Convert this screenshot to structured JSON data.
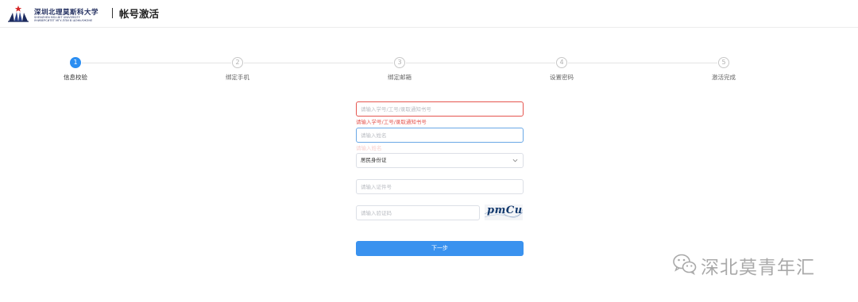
{
  "header": {
    "logo": {
      "name_cn": "深圳北理莫斯科大学",
      "name_en_lines": [
        "SHENZHEN MSU-BIT UNIVERSITY",
        "УНИВЕРСИТЕТ МГУ-ППИ В ШЭНЬЧЖЭНЕ"
      ]
    },
    "title": "帐号激活"
  },
  "steps": [
    {
      "number": "1",
      "label": "信息校验",
      "active": true
    },
    {
      "number": "2",
      "label": "绑定手机",
      "active": false
    },
    {
      "number": "3",
      "label": "绑定邮箱",
      "active": false
    },
    {
      "number": "4",
      "label": "设置密码",
      "active": false
    },
    {
      "number": "5",
      "label": "激活完成",
      "active": false
    }
  ],
  "form": {
    "student_id": {
      "placeholder": "请输入学号/工号/录取通知书号",
      "value": "",
      "error": "请输入学号/工号/录取通知书号"
    },
    "name": {
      "placeholder": "请输入姓名",
      "value": "",
      "hint": "请输入姓名"
    },
    "id_type": {
      "selected": "居民身份证"
    },
    "id_number": {
      "placeholder": "请输入证件号",
      "value": ""
    },
    "captcha": {
      "placeholder": "请输入验证码",
      "value": "",
      "image_text": "pmCu"
    },
    "next_label": "下一步"
  },
  "watermark": {
    "text": "深北莫青年汇",
    "icon": "wechat-icon"
  },
  "colors": {
    "primary": "#2b8ef2",
    "error": "#e5554f",
    "button": "#3a92ef"
  }
}
